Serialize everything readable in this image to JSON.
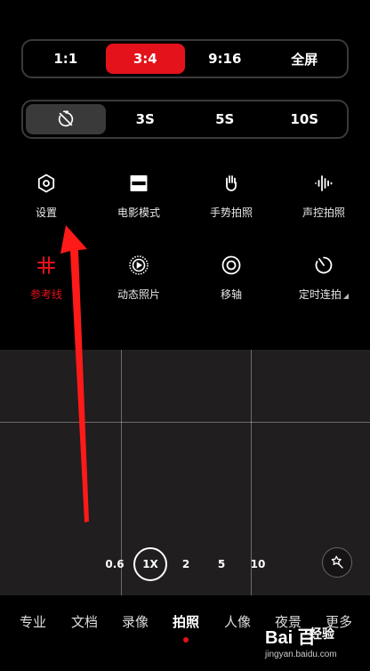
{
  "aspect_ratio": {
    "options": [
      "1:1",
      "3:4",
      "9:16",
      "全屏"
    ],
    "selected": "3:4"
  },
  "timer": {
    "options": [
      "timer-off-icon",
      "3S",
      "5S",
      "10S"
    ],
    "selected": "timer-off-icon"
  },
  "quick_settings": {
    "row1": [
      {
        "icon": "hexagon-settings-icon",
        "label": "设置"
      },
      {
        "icon": "film-frame-icon",
        "label": "电影模式"
      },
      {
        "icon": "raised-hand-icon",
        "label": "手势拍照"
      },
      {
        "icon": "sound-wave-icon",
        "label": "声控拍照"
      }
    ],
    "row2": [
      {
        "icon": "grid-hash-icon",
        "label": "参考线",
        "active": true
      },
      {
        "icon": "live-photo-icon",
        "label": "动态照片"
      },
      {
        "icon": "tilt-shift-icon",
        "label": "移轴"
      },
      {
        "icon": "timer-burst-icon",
        "label": "定时连拍"
      }
    ]
  },
  "zoom": {
    "levels": [
      "0.6",
      "1X",
      "2",
      "5",
      "10"
    ],
    "selected": "1X",
    "magic_icon": "magic-wand-icon"
  },
  "modes": {
    "items": [
      "专业",
      "文档",
      "录像",
      "拍照",
      "人像",
      "夜景",
      "更多"
    ],
    "selected": "拍照"
  },
  "watermark": {
    "logo": "Bai 百",
    "text": "经验",
    "url": "jingyan.baidu.com"
  },
  "colors": {
    "accent": "#e3121b",
    "background": "#000000",
    "viewfinder": "#201e1f"
  }
}
